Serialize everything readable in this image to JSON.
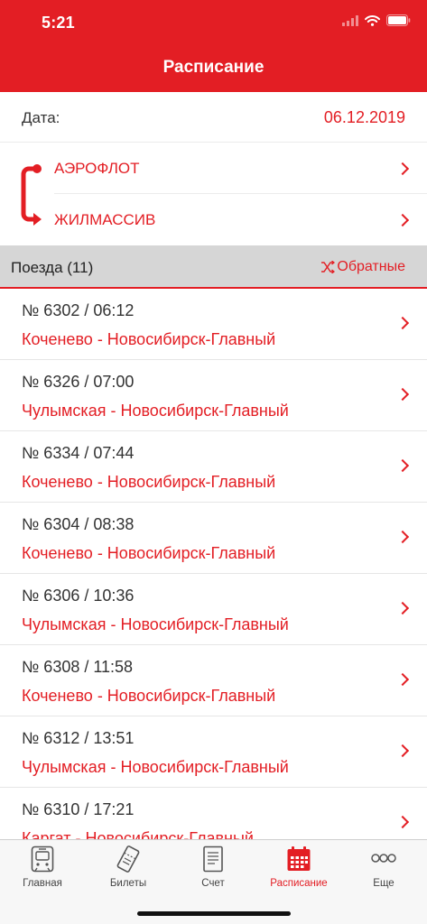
{
  "status_bar": {
    "time": "5:21"
  },
  "header": {
    "title": "Расписание"
  },
  "date": {
    "label": "Дата:",
    "value": "06.12.2019"
  },
  "route": {
    "from": "АЭРОФЛОТ",
    "to": "ЖИЛМАССИВ"
  },
  "section": {
    "title": "Поезда (11)",
    "reverse_label": "Обратные"
  },
  "trains": [
    {
      "number": "№ 6302 / 06:12",
      "route": "Коченево - Новосибирск-Главный"
    },
    {
      "number": "№ 6326 / 07:00",
      "route": "Чулымская - Новосибирск-Главный"
    },
    {
      "number": "№ 6334 / 07:44",
      "route": "Коченево - Новосибирск-Главный"
    },
    {
      "number": "№ 6304 / 08:38",
      "route": "Коченево - Новосибирск-Главный"
    },
    {
      "number": "№ 6306 / 10:36",
      "route": "Чулымская - Новосибирск-Главный"
    },
    {
      "number": "№ 6308 / 11:58",
      "route": "Коченево - Новосибирск-Главный"
    },
    {
      "number": "№ 6312 / 13:51",
      "route": "Чулымская - Новосибирск-Главный"
    },
    {
      "number": "№ 6310 / 17:21",
      "route": "Каргат - Новосибирск-Главный"
    }
  ],
  "tabbar": {
    "items": [
      {
        "label": "Главная",
        "icon": "train-icon"
      },
      {
        "label": "Билеты",
        "icon": "ticket-icon"
      },
      {
        "label": "Счет",
        "icon": "receipt-icon"
      },
      {
        "label": "Расписание",
        "icon": "calendar-icon",
        "active": true
      },
      {
        "label": "Еще",
        "icon": "more-icon"
      }
    ]
  },
  "colors": {
    "accent": "#e31e24",
    "section_bg": "#d6d6d6",
    "tabbar_bg": "#f7f7f7"
  }
}
